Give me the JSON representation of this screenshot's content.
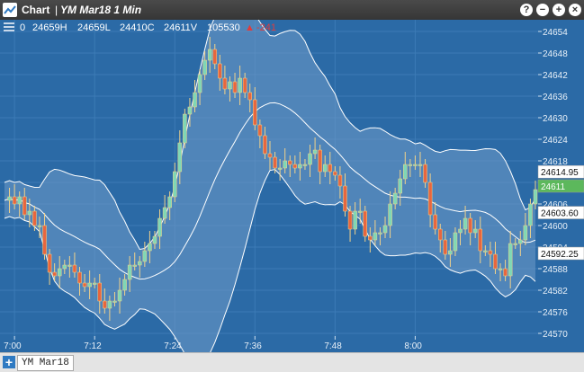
{
  "titlebar": {
    "app_name": "Chart",
    "separator": "|",
    "symbol_title": "YM Mar18 1 Min",
    "help_label": "?",
    "minimize_label": "−",
    "add_label": "+",
    "close_label": "×"
  },
  "infobar": {
    "open": "0",
    "high": "24659H",
    "low": "24659L",
    "close": "24410C",
    "volume": "24611V",
    "extra": "105530",
    "change": "-241",
    "change_arrow": "▲"
  },
  "price_tags": {
    "upper_band": "24614.95",
    "last_price": "24611",
    "middle_band": "24603.60",
    "lower_band": "24592.25"
  },
  "bottom": {
    "add_label": "+",
    "tab_label": "YM Mar18"
  },
  "colors": {
    "background": "#2b6aa6",
    "band_fill": "#6f9bc8",
    "up_candle": "#7fd8b6",
    "down_candle": "#e8663e",
    "last_price_tag": "#5cb85c",
    "change_negative": "#e23b3b"
  },
  "chart_data": {
    "type": "candlestick",
    "y_ticks": [
      24654,
      24648,
      24642,
      24636,
      24630,
      24624,
      24618,
      24612,
      24606,
      24600,
      24594,
      24588,
      24582,
      24576,
      24570
    ],
    "ylim": [
      24569,
      24656
    ],
    "x_ticks": [
      "7:00",
      "7:12",
      "7:24",
      "7:36",
      "7:48",
      "8:00"
    ],
    "indicator": "bollinger_bands",
    "close_series": [
      24607,
      24608,
      24606,
      24608,
      24603,
      24604,
      24600,
      24600,
      24592,
      24587,
      24586,
      24588,
      24589,
      24589,
      24587,
      24584,
      24583,
      24584,
      24584,
      24579,
      24577,
      24579,
      24579,
      24582,
      24585,
      24589,
      24589,
      24590,
      24593,
      24595,
      24597,
      24602,
      24605,
      24608,
      24615,
      24623,
      24631,
      24633,
      24637,
      24642,
      24646,
      24649,
      24645,
      24641,
      24638,
      24640,
      24637,
      24641,
      24637,
      24635,
      24628,
      24625,
      24620,
      24619,
      24616,
      24616,
      24618,
      24617,
      24616,
      24617,
      24617,
      24620,
      24621,
      24615,
      24617,
      24615,
      24614,
      24611,
      24604,
      24599,
      24604,
      24604,
      24597,
      24596,
      24598,
      24598,
      24600,
      24606,
      24609,
      24613,
      24617,
      24617,
      24617,
      24617,
      24612,
      24603,
      24599,
      24596,
      24592,
      24593,
      24598,
      24599,
      24602,
      24598,
      24599,
      24593,
      24593,
      24592,
      24588,
      24588,
      24586,
      24595,
      24595,
      24596,
      24600,
      24606,
      24610
    ]
  }
}
